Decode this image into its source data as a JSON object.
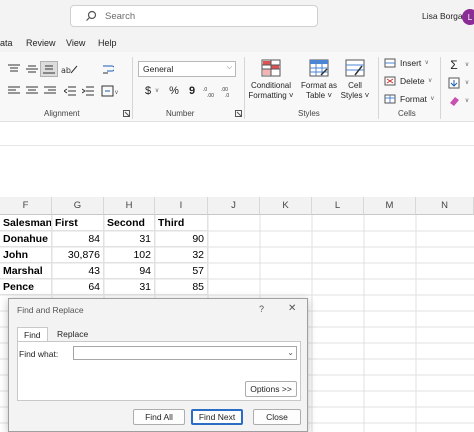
{
  "titlebar": {
    "search_placeholder": "Search",
    "user_name": "Lisa Borga",
    "avatar_initial": "L"
  },
  "menu": [
    "ata",
    "Review",
    "View",
    "Help"
  ],
  "ribbon": {
    "groups": [
      "Alignment",
      "Number",
      "Styles",
      "Cells"
    ],
    "number_format": "General",
    "conditional_formatting": [
      "Conditional",
      "Formatting ˅"
    ],
    "format_as_table": [
      "Format as",
      "Table ˅"
    ],
    "cell_styles": [
      "Cell",
      "Styles ˅"
    ],
    "insert_label": "Insert",
    "delete_label": "Delete",
    "format_label": "Format",
    "currency_symbol": "$",
    "percent_symbol": "%",
    "comma_symbol": "9"
  },
  "sheet": {
    "columns": [
      "F",
      "G",
      "H",
      "I",
      "J",
      "K",
      "L",
      "M",
      "N"
    ],
    "rows": [
      [
        "Salesman",
        "First",
        "Second",
        "Third"
      ],
      [
        "Donahue",
        "84",
        "31",
        "90"
      ],
      [
        "John",
        "30,876",
        "102",
        "32"
      ],
      [
        "Marshal",
        "43",
        "94",
        "57"
      ],
      [
        "Pence",
        "64",
        "31",
        "85"
      ]
    ]
  },
  "dialog": {
    "title": "Find and Replace",
    "help_symbol": "?",
    "close_symbol": "✕",
    "tabs": [
      "Find",
      "Replace"
    ],
    "find_what_label": "Find what:",
    "find_what_value": "",
    "options_label": "Options >>",
    "find_all_label": "Find All",
    "find_next_label": "Find Next",
    "close_label": "Close"
  },
  "colors": {
    "accent": "#2b6cc4",
    "avatar": "#8a2b96"
  }
}
